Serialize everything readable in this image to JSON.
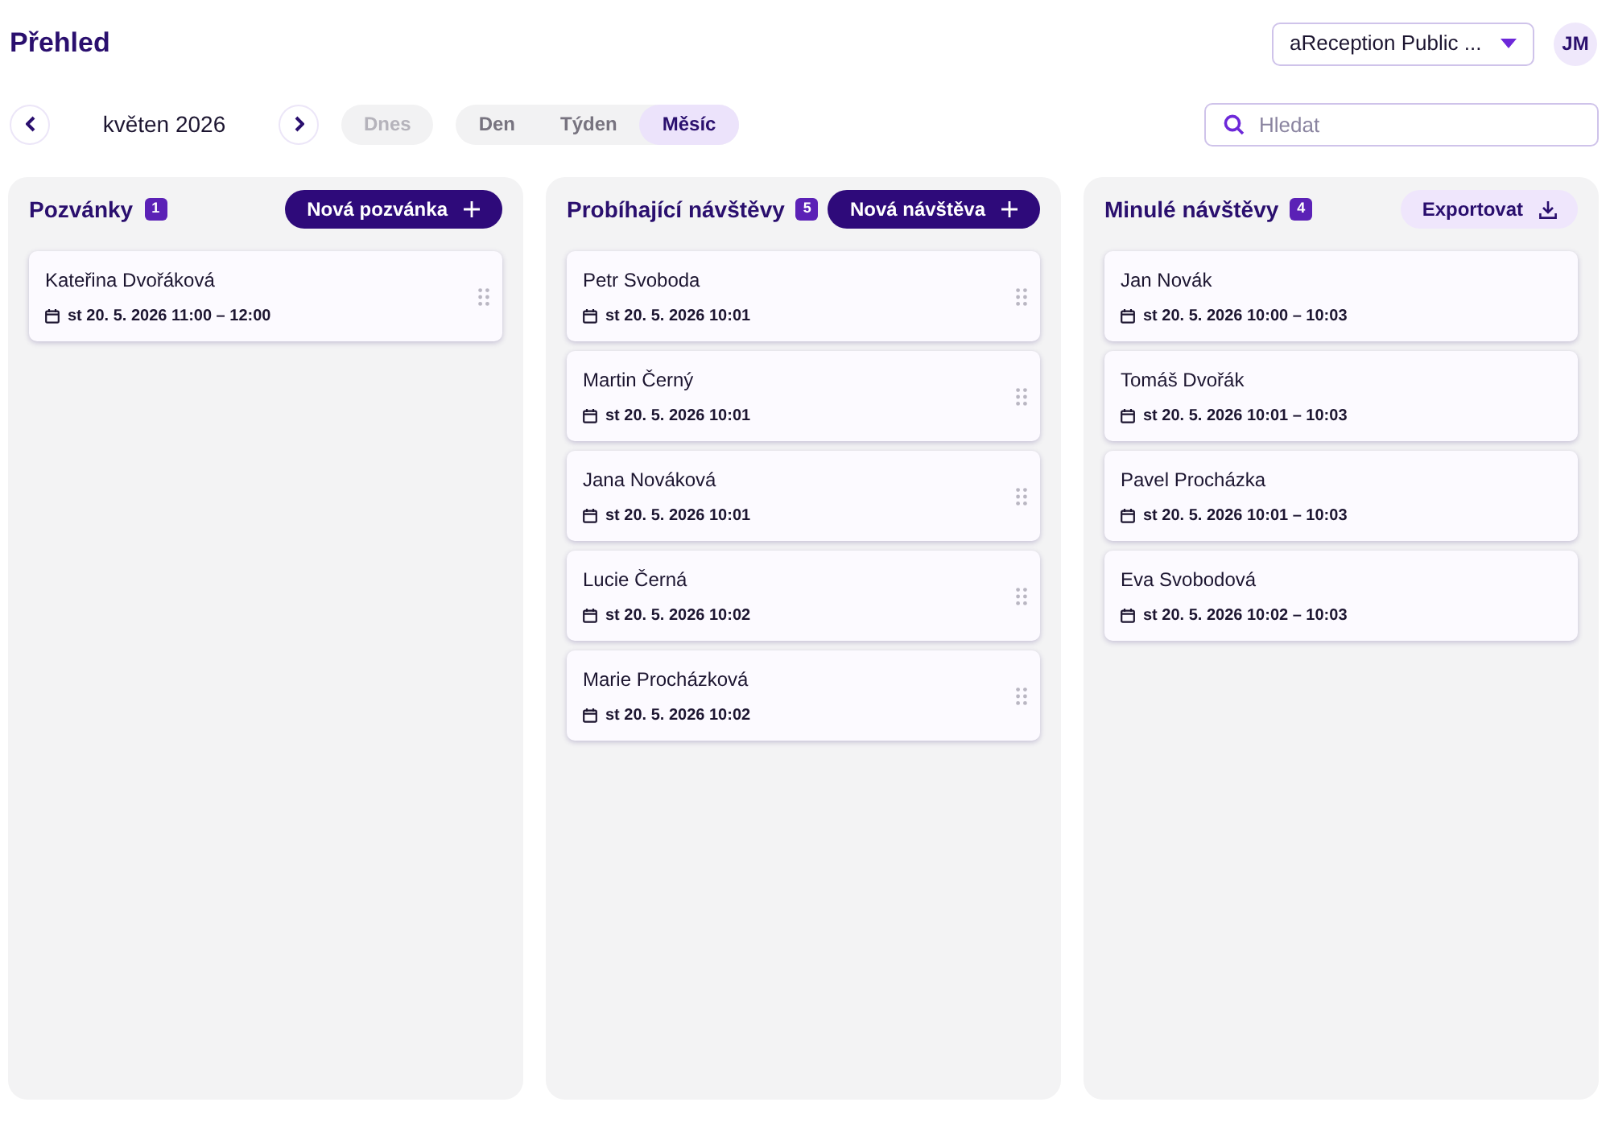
{
  "title": "Přehled",
  "workspace_select": {
    "value": "aReception Public ..."
  },
  "avatar": "JM",
  "period": "květen 2026",
  "today_button": {
    "label": "Dnes",
    "disabled": true
  },
  "view_tabs": [
    {
      "label": "Den",
      "selected": false
    },
    {
      "label": "Týden",
      "selected": false
    },
    {
      "label": "Měsíc",
      "selected": true
    }
  ],
  "search": {
    "placeholder": "Hledat"
  },
  "columns": [
    {
      "title": "Pozvánky",
      "count": "1",
      "action": {
        "kind": "primary",
        "label": "Nová pozvánka"
      },
      "cards": [
        {
          "name": "Kateřina Dvořáková",
          "time": "st 20. 5. 2026 11:00 – 12:00",
          "draggable": true
        }
      ]
    },
    {
      "title": "Probíhající návštěvy",
      "count": "5",
      "action": {
        "kind": "primary",
        "label": "Nová návštěva"
      },
      "cards": [
        {
          "name": "Petr Svoboda",
          "time": "st 20. 5. 2026 10:01",
          "draggable": true
        },
        {
          "name": "Martin Černý",
          "time": "st 20. 5. 2026 10:01",
          "draggable": true
        },
        {
          "name": "Jana Nováková",
          "time": "st 20. 5. 2026 10:01",
          "draggable": true
        },
        {
          "name": "Lucie Černá",
          "time": "st 20. 5. 2026 10:02",
          "draggable": true
        },
        {
          "name": "Marie Procházková",
          "time": "st 20. 5. 2026 10:02",
          "draggable": true
        }
      ]
    },
    {
      "title": "Minulé návštěvy",
      "count": "4",
      "action": {
        "kind": "export",
        "label": "Exportovat"
      },
      "cards": [
        {
          "name": "Jan Novák",
          "time": "st 20. 5. 2026 10:00 – 10:03",
          "draggable": false
        },
        {
          "name": "Tomáš Dvořák",
          "time": "st 20. 5. 2026 10:01 – 10:03",
          "draggable": false
        },
        {
          "name": "Pavel Procházka",
          "time": "st 20. 5. 2026 10:01 – 10:03",
          "draggable": false
        },
        {
          "name": "Eva Svobodová",
          "time": "st 20. 5. 2026 10:02 – 10:03",
          "draggable": false
        }
      ]
    }
  ]
}
